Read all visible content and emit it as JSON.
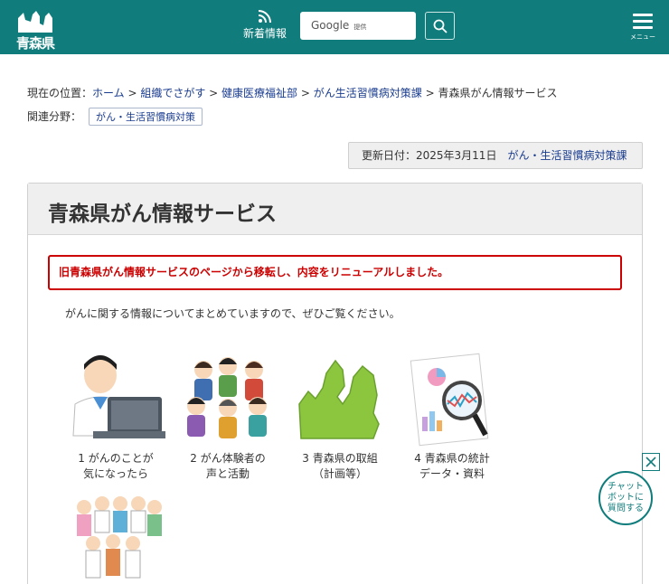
{
  "header": {
    "logo_text": "青森県",
    "news_label": "新着情報",
    "search_brand": "Google",
    "search_suffix": "提供",
    "menu_label": "メニュー"
  },
  "breadcrumb": {
    "prefix": "現在の位置：",
    "items": [
      "ホーム",
      "組織でさがす",
      "健康医療福祉部",
      "がん生活習慣病対策課"
    ],
    "separator": " > ",
    "current": "青森県がん情報サービス"
  },
  "related": {
    "label": "関連分野：",
    "tag": "がん・生活習慣病対策"
  },
  "updated": {
    "text": "更新日付：2025年3月11日",
    "dept_link": "がん・生活習慣病対策課"
  },
  "page": {
    "title": "青森県がん情報サービス",
    "notice": "旧青森県がん情報サービスのページから移転し、内容をリニューアルしました。",
    "intro": "がんに関する情報についてまとめていますので、ぜひご覧ください。"
  },
  "cards": [
    {
      "line1": "1 がんのことが",
      "line2": "気になったら"
    },
    {
      "line1": "2 がん体験者の",
      "line2": "声と活動"
    },
    {
      "line1": "3 青森県の取組",
      "line2": "（計画等）"
    },
    {
      "line1": "4 青森県の統計",
      "line2": "データ・資料"
    }
  ],
  "chat": {
    "line1": "チャット",
    "line2": "ボットに",
    "line3": "質問する"
  },
  "colors": {
    "header": "#107c7c",
    "link": "#1a3c8f",
    "notice": "#cc0000"
  }
}
